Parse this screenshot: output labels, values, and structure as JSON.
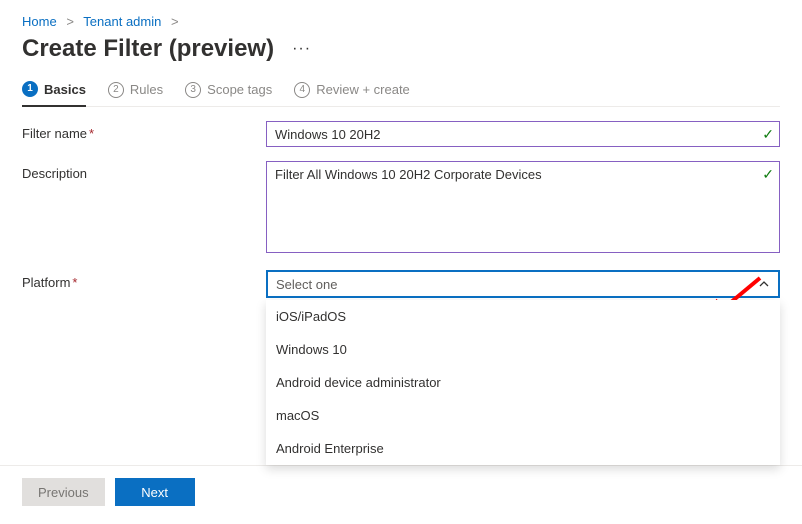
{
  "breadcrumb": {
    "home": "Home",
    "tenant": "Tenant admin"
  },
  "title": "Create Filter (preview)",
  "steps": {
    "s1": "Basics",
    "s2": "Rules",
    "s3": "Scope tags",
    "s4": "Review + create"
  },
  "form": {
    "filterName": {
      "label": "Filter name",
      "value": "Windows 10 20H2"
    },
    "description": {
      "label": "Description",
      "value": "Filter All Windows 10 20H2 Corporate Devices"
    },
    "platform": {
      "label": "Platform",
      "placeholder": "Select one",
      "options": [
        "iOS/iPadOS",
        "Windows 10",
        "Android device administrator",
        "macOS",
        "Android Enterprise"
      ]
    }
  },
  "footer": {
    "previous": "Previous",
    "next": "Next"
  }
}
